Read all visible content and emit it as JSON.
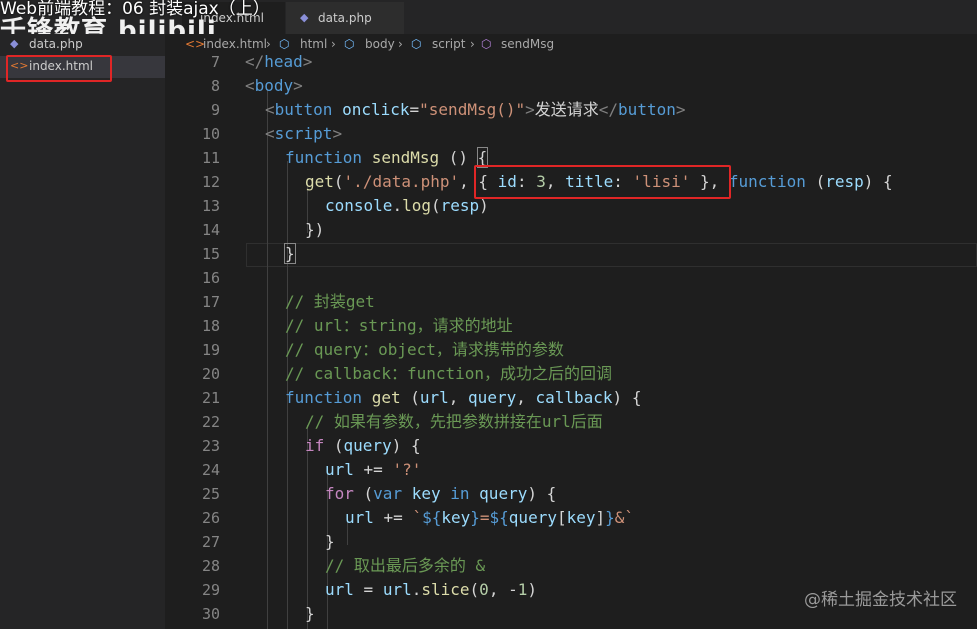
{
  "watermark": {
    "course": "Web前端教程：06 封装ajax（上）",
    "brand": "千锋教育 bilibili"
  },
  "tabs": [
    {
      "label": "index.html",
      "icon": "html-file-icon",
      "active": true
    },
    {
      "label": "data.php",
      "icon": "php-file-icon",
      "active": false
    }
  ],
  "sidebar": {
    "items": [
      {
        "label": "data.php",
        "icon": "php-file-icon"
      },
      {
        "label": "index.html",
        "icon": "html-file-icon",
        "selected": true
      }
    ]
  },
  "breadcrumb": [
    "index.html",
    "html",
    "body",
    "script",
    "sendMsg"
  ],
  "editor": {
    "lines": [
      {
        "n": "7",
        "text": "</head>"
      },
      {
        "n": "8",
        "text": "<body>"
      },
      {
        "n": "9",
        "text": "<button onclick=\"sendMsg()\">发送请求</button>"
      },
      {
        "n": "10",
        "text": "<script>"
      },
      {
        "n": "11",
        "text": "function sendMsg () {"
      },
      {
        "n": "12",
        "text": "get('./data.php', { id: 3, title: 'lisi' }, function (resp) {"
      },
      {
        "n": "13",
        "text": "console.log(resp)"
      },
      {
        "n": "14",
        "text": "})"
      },
      {
        "n": "15",
        "text": "}"
      },
      {
        "n": "16",
        "text": ""
      },
      {
        "n": "17",
        "text": "// 封装get"
      },
      {
        "n": "18",
        "text": "// url：string，请求的地址"
      },
      {
        "n": "19",
        "text": "// query：object，请求携带的参数"
      },
      {
        "n": "20",
        "text": "// callback：function，成功之后的回调"
      },
      {
        "n": "21",
        "text": "function get (url, query, callback) {"
      },
      {
        "n": "22",
        "text": "// 如果有参数，先把参数拼接在url后面"
      },
      {
        "n": "23",
        "text": "if (query) {"
      },
      {
        "n": "24",
        "text": "url += '?'"
      },
      {
        "n": "25",
        "text": "for (var key in query) {"
      },
      {
        "n": "26",
        "text": "url += `${key}=${query[key]}&`"
      },
      {
        "n": "27",
        "text": "}"
      },
      {
        "n": "28",
        "text": "// 取出最后多余的 &"
      },
      {
        "n": "29",
        "text": "url = url.slice(0, -1)"
      },
      {
        "n": "30",
        "text": "}"
      }
    ]
  },
  "footer_watermark": "@稀土掘金技术社区",
  "colors": {
    "editor_bg": "#1e1e1e",
    "sidebar_bg": "#252526",
    "keyword": "#569cd6",
    "string": "#ce9178",
    "function": "#dcdcaa",
    "comment": "#6a9955",
    "highlight_box": "#e02626"
  }
}
